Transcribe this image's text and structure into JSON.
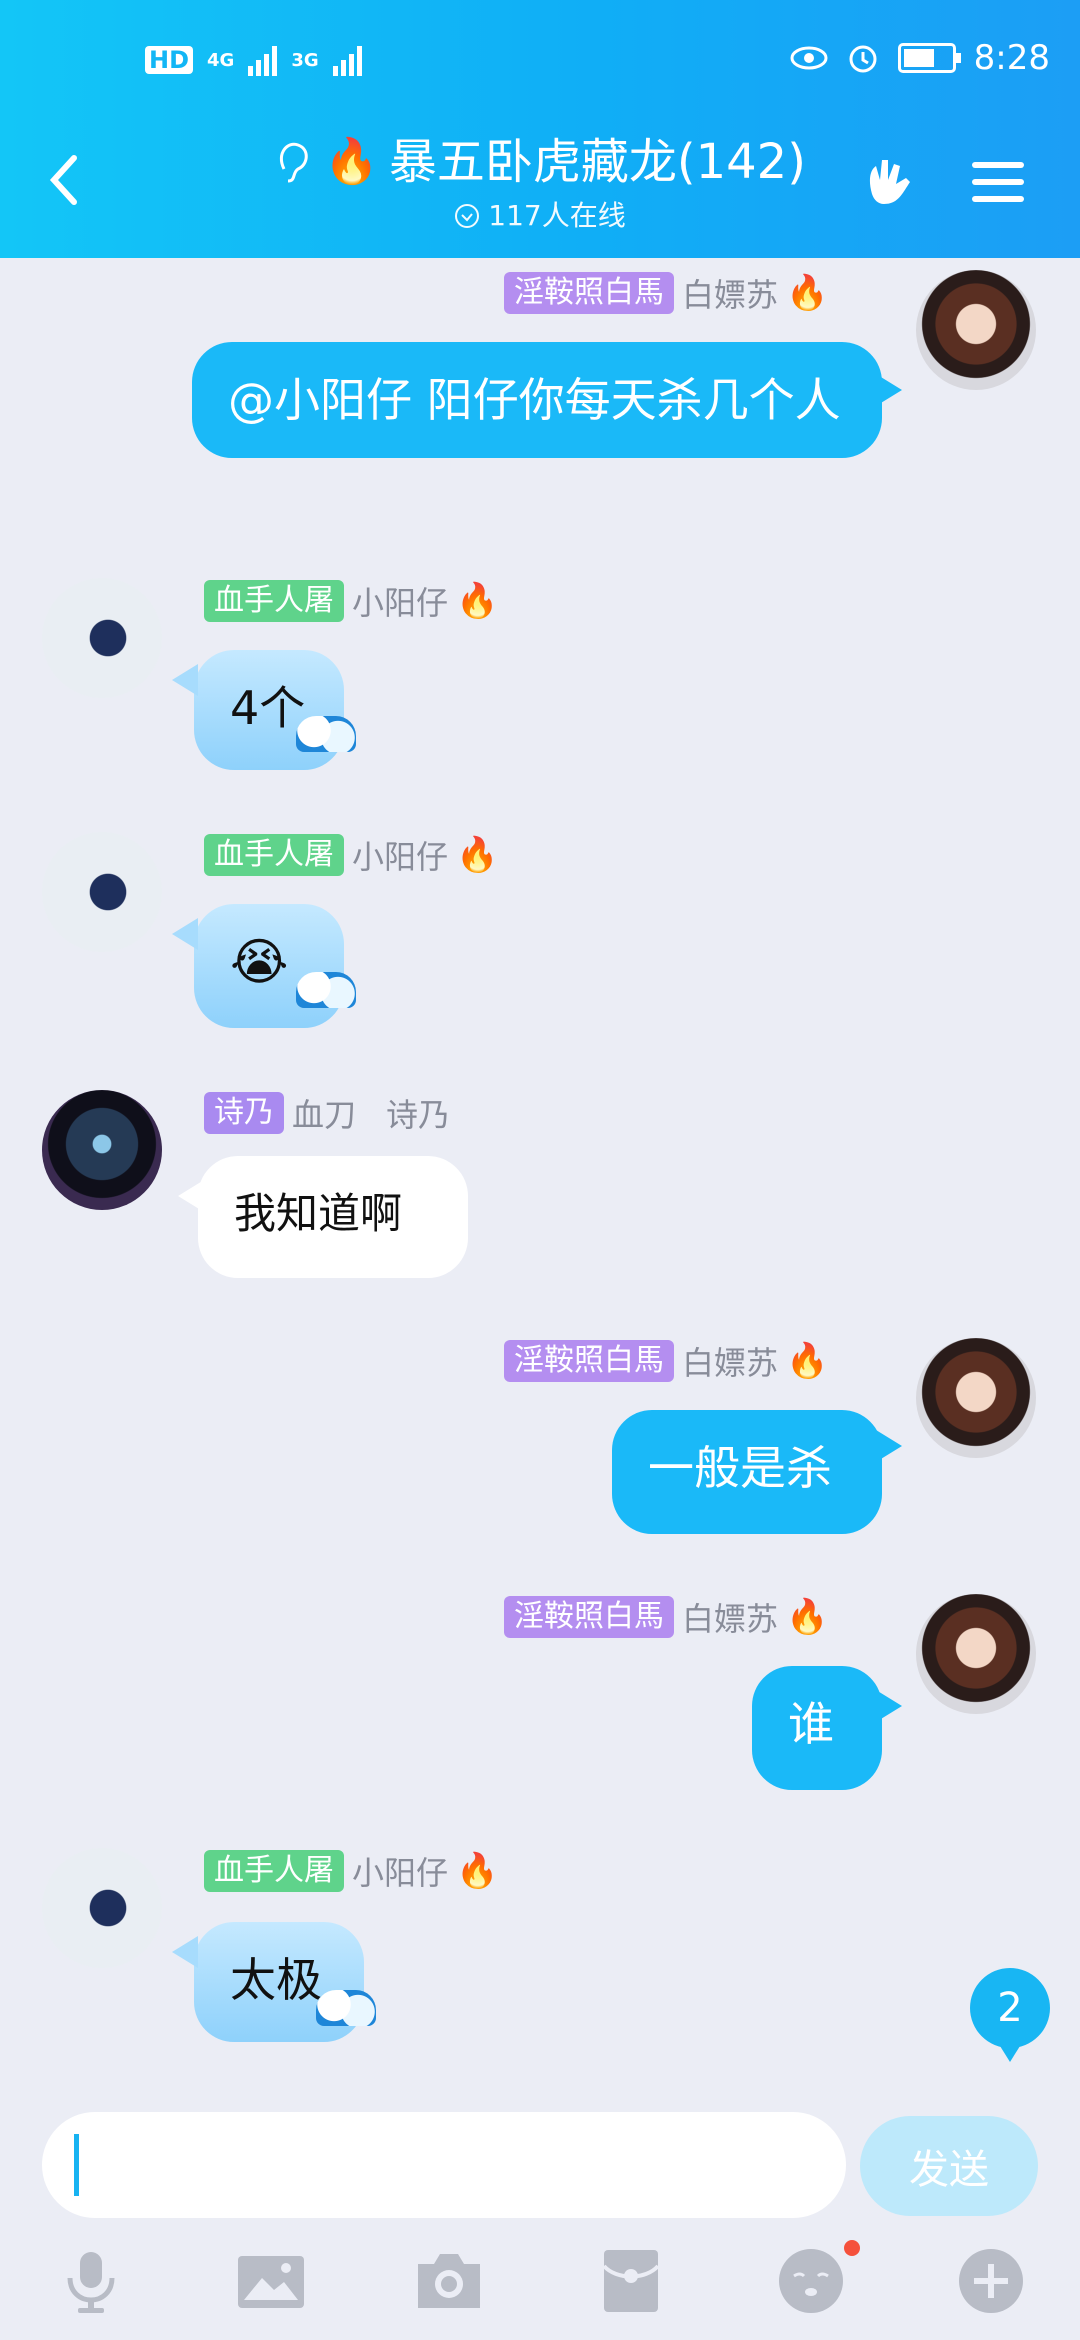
{
  "status_bar": {
    "network_1": "4G",
    "network_2": "3G",
    "time": "8:28",
    "hd": "HD"
  },
  "header": {
    "title": "暴五卧虎藏龙(142)",
    "online": "117人在线"
  },
  "messages": [
    {
      "side": "right",
      "badge": "淫鞍照白馬",
      "sender": "白嫖苏",
      "text": "@小阳仔 阳仔你每天杀几个人"
    },
    {
      "side": "left",
      "badge": "血手人屠",
      "sender": "小阳仔",
      "text": "4个"
    },
    {
      "side": "left",
      "badge": "血手人屠",
      "sender": "小阳仔",
      "text": "😭"
    },
    {
      "side": "left",
      "badge": "诗乃",
      "badge2": "血刀",
      "sender": "诗乃",
      "text": "我知道啊"
    },
    {
      "side": "right",
      "badge": "淫鞍照白馬",
      "sender": "白嫖苏",
      "text": "一般是杀"
    },
    {
      "side": "right",
      "badge": "淫鞍照白馬",
      "sender": "白嫖苏",
      "text": "谁"
    },
    {
      "side": "left",
      "badge": "血手人屠",
      "sender": "小阳仔",
      "text": "太极"
    }
  ],
  "unread_count": "2",
  "input": {
    "value": "",
    "send_label": "发送"
  },
  "colors": {
    "header": "#10aef6",
    "bubble_right": "#1ab9f8",
    "badge_purple": "#b48ef0",
    "badge_green": "#5fd38b"
  },
  "toolbar_icons": [
    "microphone-icon",
    "image-icon",
    "camera-icon",
    "red-packet-icon",
    "emoji-icon",
    "plus-icon"
  ]
}
